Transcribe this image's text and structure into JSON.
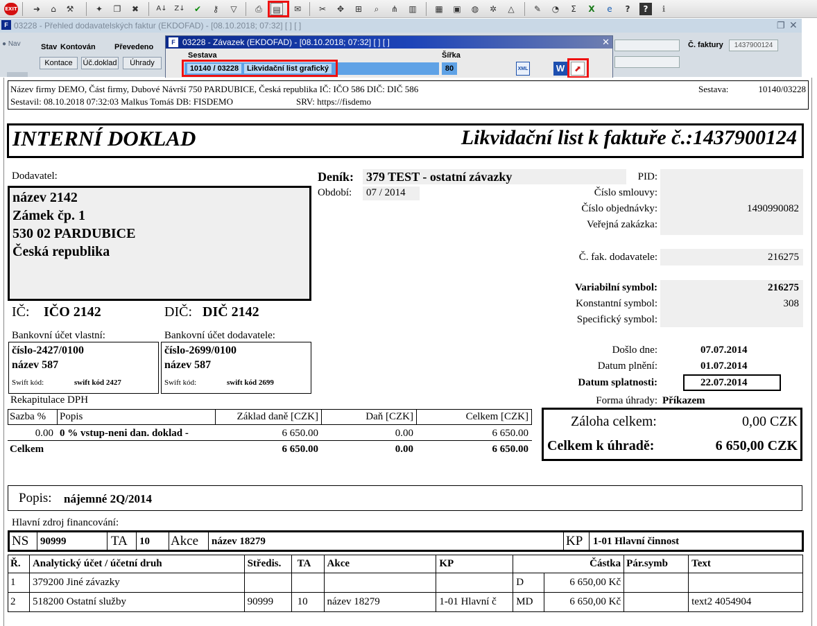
{
  "toolbar": {
    "exit_label": "EXIT"
  },
  "bg_window": {
    "title": "03228 - Přehled dodavatelských faktur (EKDOFAD) - [08.10.2018; 07:32]  [ ]  [ ]",
    "nav_label": "Nav",
    "stav_label": "Stav",
    "stav_value": "Kontován",
    "prevedeno_label": "Převedeno",
    "buttons": [
      "Kontace",
      "Úč.doklad",
      "Úhrady"
    ],
    "cislo_faktury_label": "Č. faktury",
    "cislo_faktury_value": "1437900124"
  },
  "dialog": {
    "title": "03228 - Závazek (EKDOFAD) - [08.10.2018; 07:32]  [ ]  [ ]",
    "sestava_label": "Sestava",
    "sestava_value": "10140 / 03228",
    "sestava_name": "Likvidační list grafický",
    "sirka_label": "Šířka",
    "sirka_value": "80"
  },
  "report": {
    "header": {
      "company_line": "Název firmy DEMO, Část firmy, Dubové Návrší 750 PARDUBICE, Česká republika  IČ: IČO 586  DIČ: DIČ 586",
      "sestava_label": "Sestava:",
      "sestava_value": "10140/03228",
      "sestavil_line": "Sestavil: 08.10.2018 07:32:03 Malkus Tomáš  DB: FISDEMO",
      "srv_line": "SRV: https://fisdemo"
    },
    "doc_type": "INTERNÍ DOKLAD",
    "doc_title": "Likvidační list k faktuře č.:1437900124",
    "supplier": {
      "label": "Dodavatel:",
      "lines": [
        "název 2142",
        "Zámek čp. 1",
        "530 02 PARDUBICE",
        "Česká republika"
      ],
      "ic_label": "IČ:",
      "ic_value": "IČO 2142",
      "dic_label": "DIČ:",
      "dic_value": "DIČ 2142"
    },
    "bank_own": {
      "label": "Bankovní účet vlastní:",
      "number": "číslo-2427/0100",
      "name": "název 587",
      "swift_label": "Swift kód:",
      "swift_value": "swift kód 2427"
    },
    "bank_supplier": {
      "label": "Bankovní účet dodavatele:",
      "number": "číslo-2699/0100",
      "name": "název 587",
      "swift_label": "Swift kód:",
      "swift_value": "swift kód 2699"
    },
    "journal": {
      "denik_label": "Deník:",
      "denik_value": "379 TEST - ostatní závazky",
      "obdobi_label": "Období:",
      "obdobi_value": "07 / 2014"
    },
    "right_fields": {
      "pid_label": "PID:",
      "smlouvy_label": "Číslo smlouvy:",
      "objednavky_label": "Číslo objednávky:",
      "objednavky_value": "1490990082",
      "zakazka_label": "Veřejná zakázka:",
      "cfak_label": "Č. fak. dodavatele:",
      "cfak_value": "216275",
      "vs_label": "Variabilní symbol:",
      "vs_value": "216275",
      "ks_label": "Konstantní symbol:",
      "ks_value": "308",
      "ss_label": "Specifický symbol:",
      "doslo_label": "Došlo dne:",
      "doslo_value": "07.07.2014",
      "plneni_label": "Datum plnění:",
      "plneni_value": "01.07.2014",
      "splatnost_label": "Datum splatnosti:",
      "splatnost_value": "22.07.2014",
      "forma_label": "Forma úhrady:",
      "forma_value": "Příkazem"
    },
    "totals": {
      "zaloha_label": "Záloha celkem:",
      "zaloha_value": "0,00 CZK",
      "celkem_label": "Celkem k úhradě:",
      "celkem_value": "6 650,00 CZK"
    },
    "vat": {
      "title": "Rekapitulace DPH",
      "headers": [
        "Sazba %",
        "Popis",
        "Základ daně [CZK]",
        "Daň [CZK]",
        "Celkem [CZK]"
      ],
      "row": [
        "0.00",
        "0 % vstup-neni dan. doklad -",
        "6 650.00",
        "0.00",
        "6 650.00"
      ],
      "total": [
        "Celkem",
        "6 650.00",
        "0.00",
        "6 650.00"
      ]
    },
    "popis": {
      "label": "Popis:",
      "value": "nájemné 2Q/2014"
    },
    "financing": {
      "label": "Hlavní zdroj financování:",
      "ns_label": "NS",
      "ns_value": "90999",
      "ta_label": "TA",
      "ta_value": "10",
      "akce_label": "Akce",
      "akce_value": "název 18279",
      "kp_label": "KP",
      "kp_value": "1-01 Hlavní činnost"
    },
    "accounts": {
      "headers": [
        "Ř.",
        "Analytický účet / účetní druh",
        "Středis.",
        "TA",
        "Akce",
        "KP",
        "Částka",
        "Pár.symb",
        "Text"
      ],
      "rows": [
        [
          "1",
          "379200 Jiné závazky",
          "",
          "",
          "",
          "",
          "D",
          "6 650,00 Kč",
          "",
          ""
        ],
        [
          "2",
          "518200 Ostatní služby",
          "90999",
          "10",
          "název 18279",
          "1-01 Hlavní č",
          "MD",
          "6 650,00 Kč",
          "",
          "text2 4054904"
        ]
      ]
    }
  }
}
